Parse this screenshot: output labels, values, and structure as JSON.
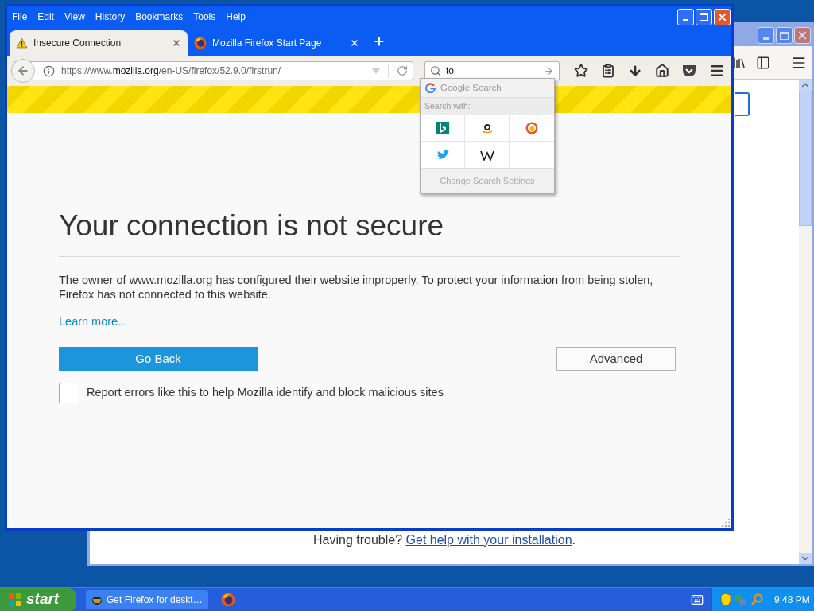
{
  "background_window": {
    "footer": {
      "text": "Having trouble?",
      "link": "Get help with your installation",
      "end": "."
    }
  },
  "menu": [
    "File",
    "Edit",
    "View",
    "History",
    "Bookmarks",
    "Tools",
    "Help"
  ],
  "tabs": [
    {
      "title": "Insecure Connection",
      "kind": "warning",
      "selected": true
    },
    {
      "title": "Mozilla Firefox Start Page",
      "kind": "firefox",
      "selected": false
    }
  ],
  "address": {
    "url": "https://www.**mozilla.org**/en-US/firefox/52.9.0/firstrun/"
  },
  "search": {
    "value": "to"
  },
  "search_popup": {
    "suggestion": "Google Search",
    "header": "Search with:",
    "settings": "Change Search Settings"
  },
  "error_page": {
    "title": "Your connection is not secure",
    "description": "The owner of www.mozilla.org has configured their website improperly. To protect your information from being stolen, Firefox has not connected to this website.",
    "learn_more": "Learn more...",
    "go_back": "Go Back",
    "advanced": "Advanced",
    "report": {
      "label": "Report errors like this to help Mozilla identify and block malicious sites",
      "checked": false
    }
  },
  "taskbar": {
    "start": "start",
    "tasks": [
      {
        "title": "Get Firefox for deskt…",
        "kind": "bug"
      },
      {
        "kind": "firefox"
      }
    ],
    "clock": "9:48 PM"
  }
}
